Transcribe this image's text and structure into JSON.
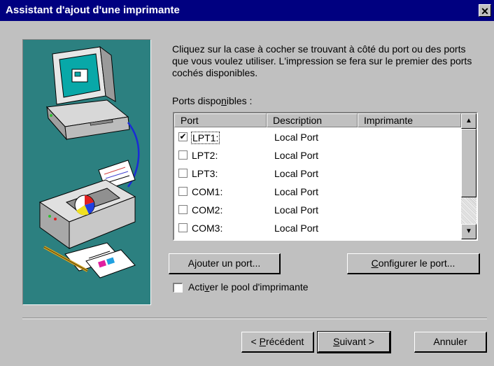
{
  "window": {
    "title": "Assistant d'ajout d'une imprimante",
    "close_glyph": "✕"
  },
  "intro": "Cliquez sur la case à cocher se trouvant à côté du port ou des ports que vous voulez utiliser. L'impression se fera sur le premier des ports cochés disponibles.",
  "ports_label": {
    "before": "Ports dispo",
    "accel": "n",
    "after": "ibles :"
  },
  "columns": [
    "Port",
    "Description",
    "Imprimante"
  ],
  "ports": [
    {
      "name": "LPT1:",
      "description": "Local Port",
      "printer": "",
      "checked": true,
      "selected": true
    },
    {
      "name": "LPT2:",
      "description": "Local Port",
      "printer": "",
      "checked": false
    },
    {
      "name": "LPT3:",
      "description": "Local Port",
      "printer": "",
      "checked": false
    },
    {
      "name": "COM1:",
      "description": "Local Port",
      "printer": "",
      "checked": false
    },
    {
      "name": "COM2:",
      "description": "Local Port",
      "printer": "",
      "checked": false
    },
    {
      "name": "COM3:",
      "description": "Local Port",
      "printer": "",
      "checked": false
    }
  ],
  "buttons": {
    "add_port": {
      "before": "A",
      "accel": "j",
      "after": "outer un port..."
    },
    "configure_port": {
      "before": "",
      "accel": "C",
      "after": "onfigurer le port..."
    },
    "back": {
      "before": "< ",
      "accel": "P",
      "after": "récédent"
    },
    "next": {
      "before": "",
      "accel": "S",
      "after": "uivant >"
    },
    "cancel": "Annuler"
  },
  "pool": {
    "before": "Acti",
    "accel": "v",
    "after": "er le pool d'imprimante",
    "checked": false
  },
  "icons": {
    "illustration": "computer-printer-illustration",
    "scroll_up": "▲",
    "scroll_down": "▼",
    "check": "✔"
  },
  "colors": {
    "titlebar": "#000080",
    "illustration_bg": "#2c8080",
    "face": "#c0c0c0"
  }
}
